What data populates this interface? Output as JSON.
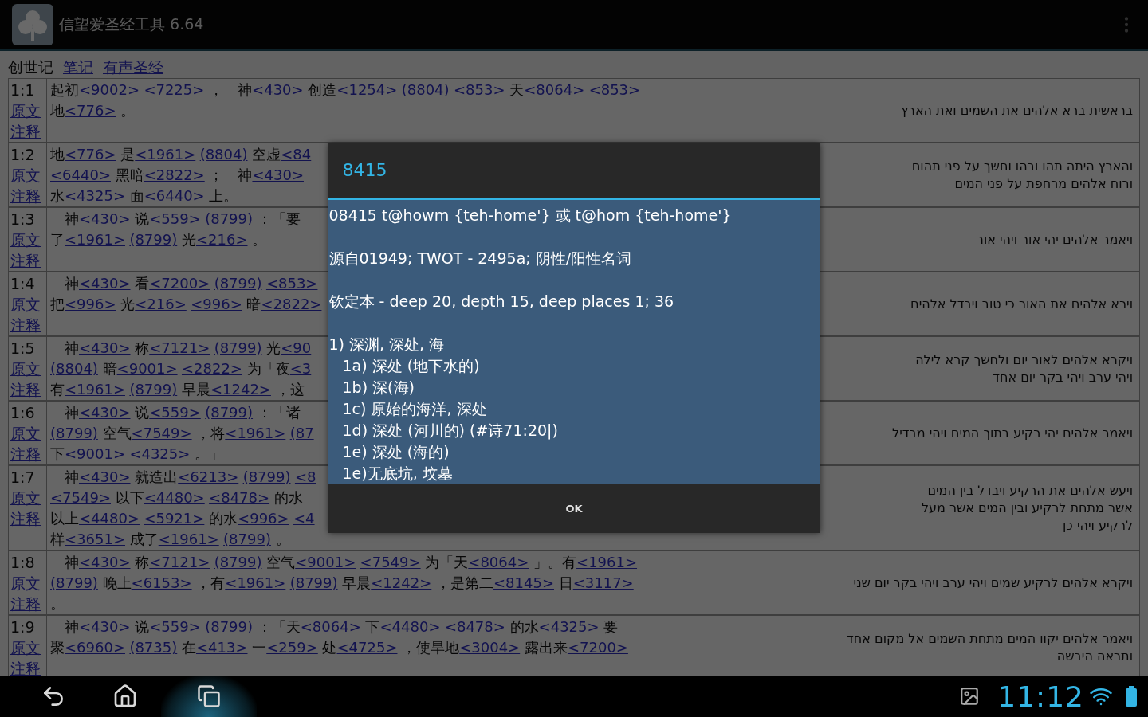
{
  "app_bar": {
    "title": "信望爱圣经工具 6.64"
  },
  "header": {
    "book": "创世记",
    "links": [
      "笔记",
      "有声圣经"
    ]
  },
  "verses": [
    {
      "ref": "1:1",
      "original_link": "原文",
      "notes_link": "注释",
      "lines": [
        [
          {
            "text": "起初"
          },
          {
            "link": "<9002>"
          },
          {
            "link": "<7225>"
          },
          {
            "text": " ，　神"
          },
          {
            "link": "<430>"
          },
          {
            "text": " 创造"
          },
          {
            "link": "<1254>"
          },
          {
            "link": "(8804)"
          },
          {
            "link": "<853>"
          },
          {
            "text": " 天"
          },
          {
            "link": "<8064>"
          },
          {
            "link": "<853>"
          }
        ],
        [
          {
            "text": "地"
          },
          {
            "link": "<776>"
          },
          {
            "text": " 。"
          }
        ]
      ],
      "hebrew": [
        "בראשית ברא אלהים את השמים ואת הארץ"
      ]
    },
    {
      "ref": "1:2",
      "original_link": "原文",
      "notes_link": "注释",
      "lines": [
        [
          {
            "text": "地"
          },
          {
            "link": "<776>"
          },
          {
            "text": " 是"
          },
          {
            "link": "<1961>"
          },
          {
            "link": "(8804)"
          },
          {
            "text": " 空虚"
          },
          {
            "link": "<84"
          }
        ],
        [
          {
            "link": "<6440>"
          },
          {
            "text": " 黑暗"
          },
          {
            "link": "<2822>"
          },
          {
            "text": " ；　神"
          },
          {
            "link": "<430>"
          }
        ],
        [
          {
            "text": "水"
          },
          {
            "link": "<4325>"
          },
          {
            "text": " 面"
          },
          {
            "link": "<6440>"
          },
          {
            "text": " 上。"
          }
        ]
      ],
      "hebrew": [
        "והארץ היתה תהו ובהו וחשך על פני תהום",
        "ורוח אלהים מרחפת על פני המים"
      ]
    },
    {
      "ref": "1:3",
      "original_link": "原文",
      "notes_link": "注释",
      "lines": [
        [
          {
            "text": "　神"
          },
          {
            "link": "<430>"
          },
          {
            "text": " 说"
          },
          {
            "link": "<559>"
          },
          {
            "link": "(8799)"
          },
          {
            "text": " ：「要"
          }
        ],
        [
          {
            "text": "了"
          },
          {
            "link": "<1961>"
          },
          {
            "link": "(8799)"
          },
          {
            "text": " 光"
          },
          {
            "link": "<216>"
          },
          {
            "text": " 。"
          }
        ]
      ],
      "hebrew": [
        "ויאמר אלהים יהי אור ויהי אור"
      ]
    },
    {
      "ref": "1:4",
      "original_link": "原文",
      "notes_link": "注释",
      "lines": [
        [
          {
            "text": "　神"
          },
          {
            "link": "<430>"
          },
          {
            "text": " 看"
          },
          {
            "link": "<7200>"
          },
          {
            "link": "(8799)"
          },
          {
            "link": "<853>"
          }
        ],
        [
          {
            "text": "把"
          },
          {
            "link": "<996>"
          },
          {
            "text": " 光"
          },
          {
            "link": "<216>"
          },
          {
            "link": "<996>"
          },
          {
            "text": " 暗"
          },
          {
            "link": "<2822>"
          }
        ]
      ],
      "hebrew": [
        "וירא אלהים את האור כי טוב ויבדל אלהים"
      ]
    },
    {
      "ref": "1:5",
      "original_link": "原文",
      "notes_link": "注释",
      "lines": [
        [
          {
            "text": "　神"
          },
          {
            "link": "<430>"
          },
          {
            "text": " 称"
          },
          {
            "link": "<7121>"
          },
          {
            "link": "(8799)"
          },
          {
            "text": " 光"
          },
          {
            "link": "<90"
          }
        ],
        [
          {
            "link": "(8804)"
          },
          {
            "text": " 暗"
          },
          {
            "link": "<9001>"
          },
          {
            "link": "<2822>"
          },
          {
            "text": " 为「夜"
          },
          {
            "link": "<3"
          }
        ],
        [
          {
            "text": "有"
          },
          {
            "link": "<1961>"
          },
          {
            "link": "(8799)"
          },
          {
            "text": " 早晨"
          },
          {
            "link": "<1242>"
          },
          {
            "text": " ，这"
          }
        ]
      ],
      "hebrew": [
        "ויקרא אלהים לאור יום ולחשך קרא לילה",
        "ויהי ערב ויהי בקר יום אחד"
      ]
    },
    {
      "ref": "1:6",
      "original_link": "原文",
      "notes_link": "注释",
      "lines": [
        [
          {
            "text": "　神"
          },
          {
            "link": "<430>"
          },
          {
            "text": " 说"
          },
          {
            "link": "<559>"
          },
          {
            "link": "(8799)"
          },
          {
            "text": " ：「诸"
          }
        ],
        [
          {
            "link": "(8799)"
          },
          {
            "text": " 空气"
          },
          {
            "link": "<7549>"
          },
          {
            "text": " ，将"
          },
          {
            "link": "<1961>"
          },
          {
            "link": "(87"
          }
        ],
        [
          {
            "text": "下"
          },
          {
            "link": "<9001>"
          },
          {
            "link": "<4325>"
          },
          {
            "text": " 。」"
          }
        ]
      ],
      "hebrew": [
        "ויאמר אלהים יהי רקיע בתוך המים ויהי מבדיל"
      ]
    },
    {
      "ref": "1:7",
      "original_link": "原文",
      "notes_link": "注释",
      "lines": [
        [
          {
            "text": "　神"
          },
          {
            "link": "<430>"
          },
          {
            "text": " 就造出"
          },
          {
            "link": "<6213>"
          },
          {
            "link": "(8799)"
          },
          {
            "link": "<8"
          }
        ],
        [
          {
            "link": "<7549>"
          },
          {
            "text": " 以下"
          },
          {
            "link": "<4480>"
          },
          {
            "link": "<8478>"
          },
          {
            "text": " 的水"
          }
        ],
        [
          {
            "text": "以上"
          },
          {
            "link": "<4480>"
          },
          {
            "link": "<5921>"
          },
          {
            "text": " 的水"
          },
          {
            "link": "<996>"
          },
          {
            "link": "<4"
          }
        ],
        [
          {
            "text": "样"
          },
          {
            "link": "<3651>"
          },
          {
            "text": " 成了"
          },
          {
            "link": "<1961>"
          },
          {
            "link": "(8799)"
          },
          {
            "text": " 。"
          }
        ]
      ],
      "hebrew": [
        "ויעש אלהים את הרקיע ויבדל בין המים",
        "אשר מתחת לרקיע ובין המים אשר מעל",
        "לרקיע ויהי כן"
      ]
    },
    {
      "ref": "1:8",
      "original_link": "原文",
      "notes_link": "注释",
      "lines": [
        [
          {
            "text": "　神"
          },
          {
            "link": "<430>"
          },
          {
            "text": " 称"
          },
          {
            "link": "<7121>"
          },
          {
            "link": "(8799)"
          },
          {
            "text": " 空气"
          },
          {
            "link": "<9001>"
          },
          {
            "link": "<7549>"
          },
          {
            "text": " 为「天"
          },
          {
            "link": "<8064>"
          },
          {
            "text": " 」。有"
          },
          {
            "link": "<1961>"
          }
        ],
        [
          {
            "link": "(8799)"
          },
          {
            "text": " 晚上"
          },
          {
            "link": "<6153>"
          },
          {
            "text": " ，有"
          },
          {
            "link": "<1961>"
          },
          {
            "link": "(8799)"
          },
          {
            "text": " 早晨"
          },
          {
            "link": "<1242>"
          },
          {
            "text": " ，是第二"
          },
          {
            "link": "<8145>"
          },
          {
            "text": " 日"
          },
          {
            "link": "<3117>"
          }
        ],
        [
          {
            "text": "。"
          }
        ]
      ],
      "hebrew": [
        "ויקרא אלהים לרקיע שמים ויהי ערב ויהי בקר יום שני"
      ]
    },
    {
      "ref": "1:9",
      "original_link": "原文",
      "notes_link": "注释",
      "lines": [
        [
          {
            "text": "　神"
          },
          {
            "link": "<430>"
          },
          {
            "text": " 说"
          },
          {
            "link": "<559>"
          },
          {
            "link": "(8799)"
          },
          {
            "text": " ：「天"
          },
          {
            "link": "<8064>"
          },
          {
            "text": " 下"
          },
          {
            "link": "<4480>"
          },
          {
            "link": "<8478>"
          },
          {
            "text": " 的水"
          },
          {
            "link": "<4325>"
          },
          {
            "text": " 要"
          }
        ],
        [
          {
            "text": "聚"
          },
          {
            "link": "<6960>"
          },
          {
            "link": "(8735)"
          },
          {
            "text": " 在"
          },
          {
            "link": "<413>"
          },
          {
            "text": " 一"
          },
          {
            "link": "<259>"
          },
          {
            "text": " 处"
          },
          {
            "link": "<4725>"
          },
          {
            "text": " ，使旱地"
          },
          {
            "link": "<3004>"
          },
          {
            "text": " 露出来"
          },
          {
            "link": "<7200>"
          }
        ]
      ],
      "hebrew": [
        "ויאמר אלהים יקוו המים מתחת השמים אל מקום אחד",
        "ותראה היבשה"
      ]
    }
  ],
  "dialog": {
    "title": "8415",
    "paragraphs": [
      "08415 t@howm {teh-home'} 或 t@hom {teh-home'}",
      "源自01949; TWOT - 2495a; 阴性/阳性名词",
      "钦定本 - deep 20, depth 15, deep places 1; 36"
    ],
    "senses": [
      {
        "text": "1) 深渊, 深处, 海",
        "children": [
          {
            "text": "1a) 深处 (地下水的)"
          },
          {
            "text": "1b) 深(海)"
          },
          {
            "text": "1c) 原始的海洋, 深处"
          },
          {
            "text": "1d) 深处 (河川的) (#诗71:20|)"
          },
          {
            "text": "1e) 深处 (海的)"
          },
          {
            "text": "1e)无底坑, 坟墓"
          }
        ]
      }
    ],
    "button": "OK"
  },
  "status_bar": {
    "time": "11:12"
  }
}
